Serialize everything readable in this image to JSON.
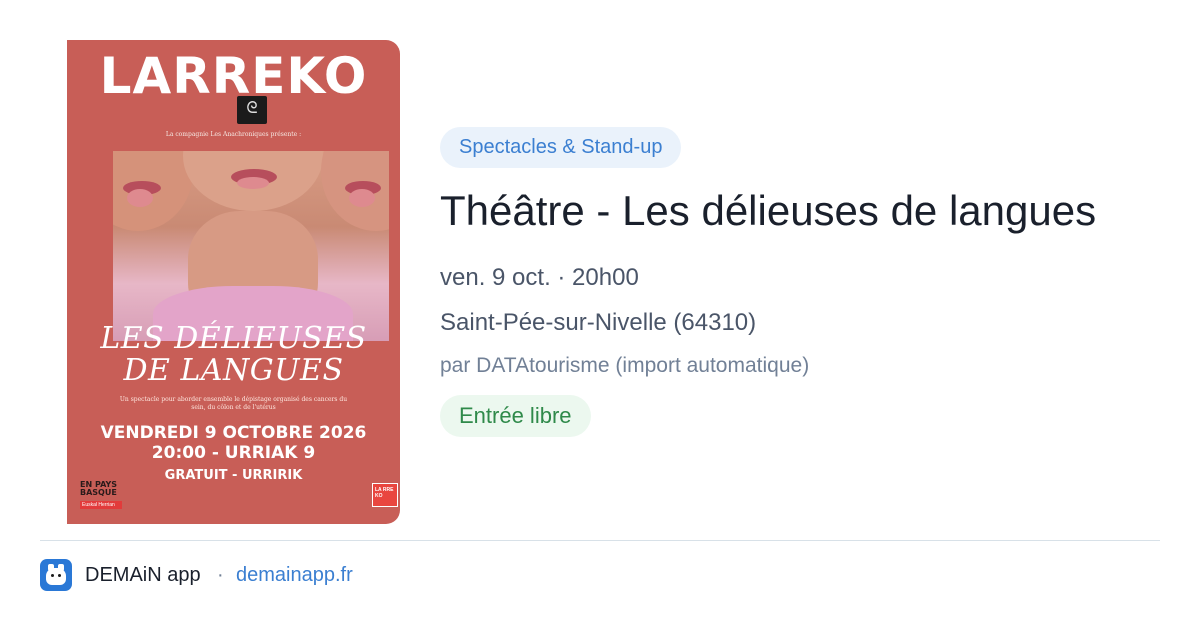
{
  "poster": {
    "logo_text": "LARREKO",
    "presents": "La compagnie Les Anachroniques présente :",
    "title_line1": "LES DÉLIEUSES",
    "title_line2": "DE LANGUES",
    "description": "Un spectacle pour aborder ensemble le dépistage organisé des cancers du sein, du côlon et de l'utérus",
    "date_line1": "VENDREDI 9 OCTOBRE 2026",
    "date_line2": "20:00 - URRIAK 9",
    "free_line": "GRATUIT - URRIRIK",
    "region_line1": "EN PAYS",
    "region_line2": "BASQUE",
    "region_tag": "Euskal Herrian",
    "corner_text": "LA RRE KO"
  },
  "event": {
    "category": "Spectacles & Stand-up",
    "title": "Théâtre - Les délieuses de langues",
    "datetime": "ven. 9 oct. · 20h00",
    "location": "Saint-Pée-sur-Nivelle (64310)",
    "source": "par DATAtourisme (import automatique)",
    "price": "Entrée libre"
  },
  "footer": {
    "app_name": "DEMAiN app",
    "separator": "·",
    "site": "demainapp.fr"
  },
  "colors": {
    "poster_bg": "#c85e57",
    "category_bg": "#eaf2fb",
    "category_text": "#3b7fd1",
    "price_bg": "#ecf8ef",
    "price_text": "#2f8a4a",
    "link": "#3b7fd1"
  }
}
